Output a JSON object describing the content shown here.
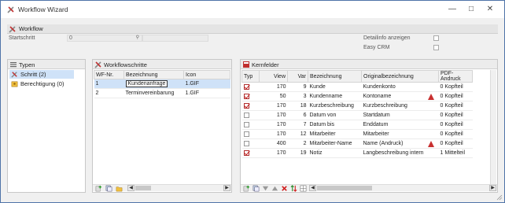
{
  "window": {
    "title": "Workflow Wizard"
  },
  "section": {
    "label": "Workflow"
  },
  "form": {
    "startschritt_label": "Startschritt",
    "startschritt_value": "0",
    "detailinfo_label": "Detailinfo anzeigen",
    "easycrm_label": "Easy CRM"
  },
  "typen": {
    "title": "Typen",
    "items": [
      {
        "label": "Schritt (2)",
        "icon": "step-tools-icon",
        "selected": true
      },
      {
        "label": "Berechtigung (0)",
        "icon": "permission-icon",
        "selected": false
      }
    ]
  },
  "workflowschritte": {
    "title": "Workflowschritte",
    "columns": [
      "WF-Nr.",
      "Bezeichnung",
      "Icon"
    ],
    "rows": [
      {
        "nr": "1",
        "bez": "Kundenanfrage",
        "icon": "1.GIF",
        "selected": true
      },
      {
        "nr": "2",
        "bez": "Terminvereinbarung",
        "icon": "1.GIF",
        "selected": false
      }
    ]
  },
  "kernfelder": {
    "title": "Kernfelder",
    "columns": [
      "Typ",
      "View",
      "Var",
      "Bezeichnung",
      "Originalbezeichnung",
      "PDF-Andruck"
    ],
    "rows": [
      {
        "typ": true,
        "view": "170",
        "var": "9",
        "bez": "Kunde",
        "orig": "Kundenkonto",
        "warn": false,
        "pdf_num": "0",
        "pdf": "Kopfteil"
      },
      {
        "typ": true,
        "view": "50",
        "var": "3",
        "bez": "Kundenname",
        "orig": "Kontoname",
        "warn": true,
        "pdf_num": "0",
        "pdf": "Kopfteil"
      },
      {
        "typ": true,
        "view": "170",
        "var": "18",
        "bez": "Kurzbeschreibung",
        "orig": "Kurzbeschreibung",
        "warn": false,
        "pdf_num": "0",
        "pdf": "Kopfteil"
      },
      {
        "typ": false,
        "view": "170",
        "var": "6",
        "bez": "Datum von",
        "orig": "Startdatum",
        "warn": false,
        "pdf_num": "0",
        "pdf": "Kopfteil"
      },
      {
        "typ": false,
        "view": "170",
        "var": "7",
        "bez": "Datum bis",
        "orig": "Enddatum",
        "warn": false,
        "pdf_num": "0",
        "pdf": "Kopfteil"
      },
      {
        "typ": false,
        "view": "170",
        "var": "12",
        "bez": "Mitarbeiter",
        "orig": "Mitarbeiter",
        "warn": false,
        "pdf_num": "0",
        "pdf": "Kopfteil"
      },
      {
        "typ": false,
        "view": "400",
        "var": "2",
        "bez": "Mitarbeiter-Name",
        "orig": "Name (Andruck)",
        "warn": true,
        "pdf_num": "0",
        "pdf": "Kopfteil"
      },
      {
        "typ": true,
        "view": "170",
        "var": "19",
        "bez": "Notiz",
        "orig": "Langbeschreibung intern",
        "warn": false,
        "pdf_num": "1",
        "pdf": "Mittelteil"
      }
    ]
  },
  "colors": {
    "accent": "#cfe2f8",
    "warn": "#c83030",
    "check": "#c02020"
  }
}
